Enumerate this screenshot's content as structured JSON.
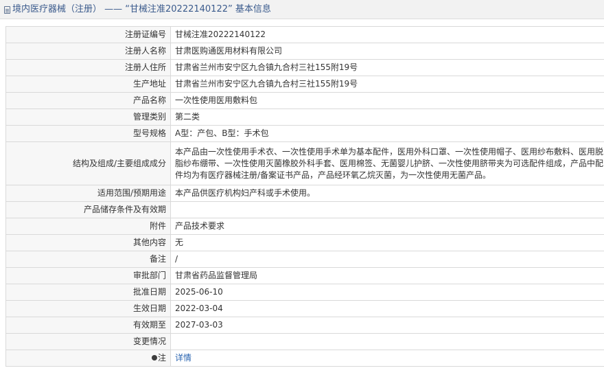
{
  "header": {
    "icon": "document-icon",
    "title": "境内医疗器械（注册） —— “甘械注准20222140122” 基本信息"
  },
  "rows": [
    {
      "label": "注册证编号",
      "value": "甘械注准20222140122"
    },
    {
      "label": "注册人名称",
      "value": "甘肃医购通医用材料有限公司"
    },
    {
      "label": "注册人住所",
      "value": "甘肃省兰州市安宁区九合镇九合村三社155附19号"
    },
    {
      "label": "生产地址",
      "value": "甘肃省兰州市安宁区九合镇九合村三社155附19号"
    },
    {
      "label": "产品名称",
      "value": "一次性使用医用敷料包"
    },
    {
      "label": "管理类别",
      "value": "第二类"
    },
    {
      "label": "型号规格",
      "value": "A型：产包、B型：手术包"
    },
    {
      "label": "结构及组成/主要组成成分",
      "value": "本产品由一次性使用手术衣、一次性使用手术单为基本配件，医用外科口罩、一次性使用帽子、医用纱布敷料、医用脱脂纱布绷带、一次性使用灭菌橡胶外科手套、医用棉签、无菌婴儿护脐、一次性使用脐带夹为可选配件组成，产品中配件均为有医疗器械注册/备案证书产品，产品经环氧乙烷灭菌，为一次性使用无菌产品。"
    },
    {
      "label": "适用范围/预期用途",
      "value": "本产品供医疗机构妇产科或手术使用。"
    },
    {
      "label": "产品储存条件及有效期",
      "value": ""
    },
    {
      "label": "附件",
      "value": "产品技术要求"
    },
    {
      "label": "其他内容",
      "value": "无"
    },
    {
      "label": "备注",
      "value": "/"
    },
    {
      "label": "审批部门",
      "value": "甘肃省药品监督管理局"
    },
    {
      "label": "批准日期",
      "value": "2025-06-10"
    },
    {
      "label": "生效日期",
      "value": "2022-03-04"
    },
    {
      "label": "有效期至",
      "value": "2027-03-03"
    },
    {
      "label": "变更情况",
      "value": ""
    }
  ],
  "note_row": {
    "icon": "pin-icon",
    "label": "注",
    "link": "详情"
  }
}
